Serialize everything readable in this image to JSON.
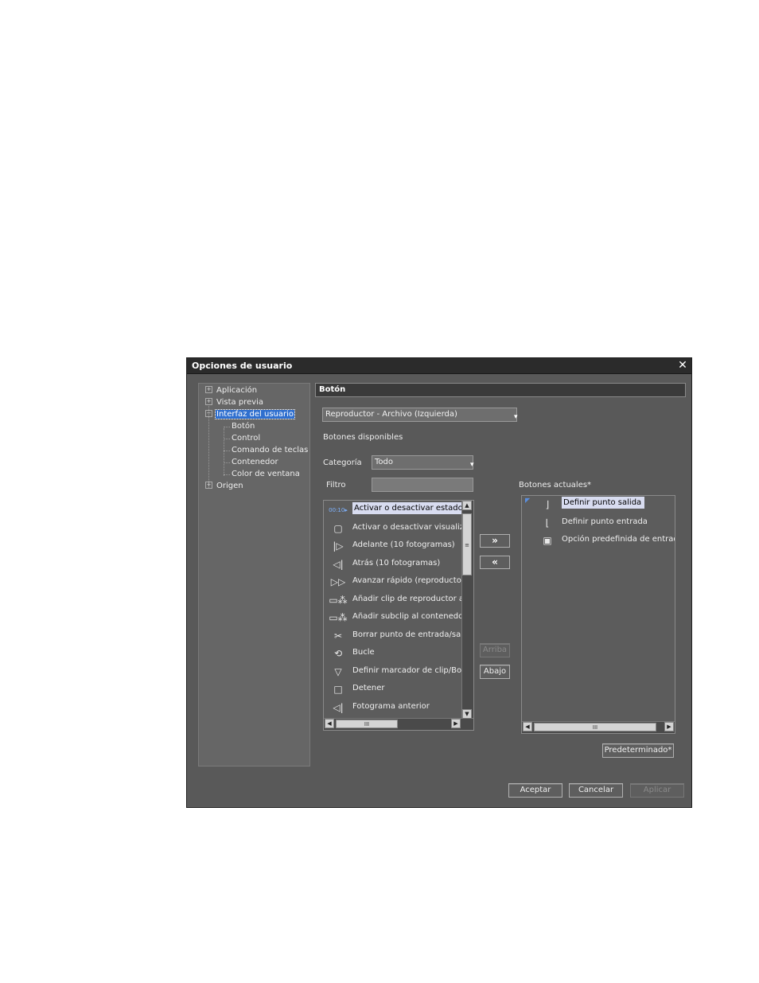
{
  "dialog": {
    "title": "Opciones de usuario",
    "close_glyph": "✕"
  },
  "tree": {
    "items": [
      {
        "label": "Aplicación",
        "expander": "+"
      },
      {
        "label": "Vista previa",
        "expander": "+"
      },
      {
        "label": "Interfaz del usuario",
        "expander": "−"
      },
      {
        "label": "Botón"
      },
      {
        "label": "Control"
      },
      {
        "label": "Comando de teclas"
      },
      {
        "label": "Contenedor"
      },
      {
        "label": "Color de ventana"
      },
      {
        "label": "Origen",
        "expander": "+"
      }
    ]
  },
  "section": {
    "header": "Botón",
    "target_combo": "Reproductor - Archivo (Izquierda)",
    "available_label": "Botones disponibles",
    "category_label": "Categoría",
    "category_value": "Todo",
    "filter_label": "Filtro",
    "filter_value": "",
    "current_label": "Botones actuales*"
  },
  "available_buttons": [
    {
      "label": "Activar o desactivar estado",
      "icon": "timecode-icon",
      "glyph": "00:10▸"
    },
    {
      "label": "Activar o desactivar visualiza",
      "icon": "display-toggle-icon",
      "glyph": "▢"
    },
    {
      "label": "Adelante (10 fotogramas)",
      "icon": "forward-10-icon",
      "glyph": "|▷"
    },
    {
      "label": "Atrás (10 fotogramas)",
      "icon": "back-10-icon",
      "glyph": "◁|"
    },
    {
      "label": "Avanzar rápido (reproductor)",
      "icon": "fast-forward-icon",
      "glyph": "▷▷"
    },
    {
      "label": "Añadir clip de reproductor al r",
      "icon": "add-clip-icon",
      "glyph": "▭⁂"
    },
    {
      "label": "Añadir subclip al contenedor",
      "icon": "add-subclip-icon",
      "glyph": "▭⁂"
    },
    {
      "label": "Borrar punto de entrada/salid",
      "icon": "clear-in-out-icon",
      "glyph": "✂"
    },
    {
      "label": "Bucle",
      "icon": "loop-icon",
      "glyph": "⟲"
    },
    {
      "label": "Definir marcador de clip/Borra",
      "icon": "clip-marker-icon",
      "glyph": "▽"
    },
    {
      "label": "Detener",
      "icon": "stop-icon",
      "glyph": "□"
    },
    {
      "label": "Fotograma anterior",
      "icon": "previous-frame-icon",
      "glyph": "◁|"
    }
  ],
  "current_buttons": [
    {
      "label": "Definir punto salida",
      "icon": "set-out-point-icon",
      "glyph": "⌋"
    },
    {
      "label": "Definir punto entrada",
      "icon": "set-in-point-icon",
      "glyph": "⌊"
    },
    {
      "label": "Opción predefinida de entrada",
      "icon": "input-preset-icon",
      "glyph": "▣"
    }
  ],
  "buttons": {
    "add": "»",
    "remove": "«",
    "up": "Arriba",
    "down": "Abajo",
    "default": "Predeterminado*",
    "ok": "Aceptar",
    "cancel": "Cancelar",
    "apply": "Aplicar"
  },
  "scroll_glyphs": {
    "up": "▲",
    "down": "▼",
    "left": "◀",
    "right": "▶",
    "grip": "III"
  }
}
